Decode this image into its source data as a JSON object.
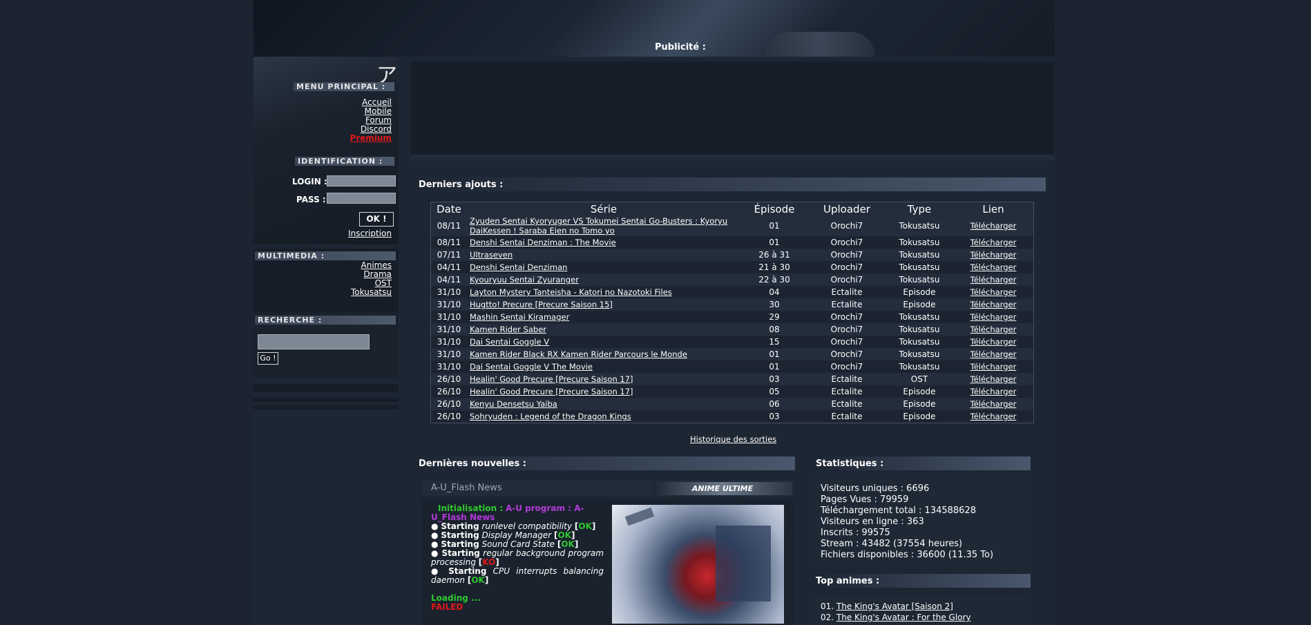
{
  "header": {
    "ad_label": "Publicité :"
  },
  "logo_glyph": "ア",
  "menu_principal": {
    "title": "Menu principal :",
    "items": [
      "Accueil",
      "Mobile",
      "Forum",
      "Discord",
      "Premium"
    ]
  },
  "identification": {
    "title": "Identification :",
    "login_label": "LOGIN :",
    "pass_label": "PASS :",
    "submit_label": "OK !",
    "register_label": "Inscription"
  },
  "multimedia": {
    "title": "Multimedia :",
    "items": [
      "Animes",
      "Drama",
      "OST",
      "Tokusatsu"
    ]
  },
  "recherche": {
    "title": "Recherche :",
    "go_label": "Go !"
  },
  "derniers_ajouts": {
    "title": "Derniers ajouts :",
    "columns": [
      "Date",
      "Série",
      "Épisode",
      "Uploader",
      "Type",
      "Lien"
    ],
    "rows": [
      {
        "date": "08/11",
        "serie": "Zyuden Sentai Kyoryuger VS Tokumei Sentai Go-Busters : Kyoryu DaiKessen ! Saraba Eien no Tomo yo",
        "episode": "01",
        "uploader": "Orochi7",
        "type": "Tokusatsu",
        "lien": "Télécharger"
      },
      {
        "date": "08/11",
        "serie": "Denshi Sentai Denziman : The Movie",
        "episode": "01",
        "uploader": "Orochi7",
        "type": "Tokusatsu",
        "lien": "Télécharger"
      },
      {
        "date": "07/11",
        "serie": "Ultraseven",
        "episode": "26 à 31",
        "uploader": "Orochi7",
        "type": "Tokusatsu",
        "lien": "Télécharger"
      },
      {
        "date": "04/11",
        "serie": "Denshi Sentai Denziman",
        "episode": "21 à 30",
        "uploader": "Orochi7",
        "type": "Tokusatsu",
        "lien": "Télécharger"
      },
      {
        "date": "04/11",
        "serie": "Kyouryuu Sentai Zyuranger",
        "episode": "22 à 30",
        "uploader": "Orochi7",
        "type": "Tokusatsu",
        "lien": "Télécharger"
      },
      {
        "date": "31/10",
        "serie": "Layton Mystery Tanteisha - Katori no Nazotoki Files",
        "episode": "04",
        "uploader": "Ectalite",
        "type": "Episode",
        "lien": "Télécharger"
      },
      {
        "date": "31/10",
        "serie": "Hugtto! Precure [Precure Saison 15]",
        "episode": "30",
        "uploader": "Ectalite",
        "type": "Episode",
        "lien": "Télécharger"
      },
      {
        "date": "31/10",
        "serie": "Mashin Sentai Kiramager",
        "episode": "29",
        "uploader": "Orochi7",
        "type": "Tokusatsu",
        "lien": "Télécharger"
      },
      {
        "date": "31/10",
        "serie": "Kamen Rider Saber",
        "episode": "08",
        "uploader": "Orochi7",
        "type": "Tokusatsu",
        "lien": "Télécharger"
      },
      {
        "date": "31/10",
        "serie": "Dai Sentai Goggle V",
        "episode": "15",
        "uploader": "Orochi7",
        "type": "Tokusatsu",
        "lien": "Télécharger"
      },
      {
        "date": "31/10",
        "serie": "Kamen Rider Black RX Kamen Rider Parcours le Monde",
        "episode": "01",
        "uploader": "Orochi7",
        "type": "Tokusatsu",
        "lien": "Télécharger"
      },
      {
        "date": "31/10",
        "serie": "Dai Sentai Goggle V The Movie",
        "episode": "01",
        "uploader": "Orochi7",
        "type": "Tokusatsu",
        "lien": "Télécharger"
      },
      {
        "date": "26/10",
        "serie": "Healin' Good Precure [Precure Saison 17]",
        "episode": "03",
        "uploader": "Ectalite",
        "type": "OST",
        "lien": "Télécharger"
      },
      {
        "date": "26/10",
        "serie": "Healin' Good Precure [Precure Saison 17]",
        "episode": "05",
        "uploader": "Ectalite",
        "type": "Episode",
        "lien": "Télécharger"
      },
      {
        "date": "26/10",
        "serie": "Kenyu Densetsu Yaiba",
        "episode": "06",
        "uploader": "Ectalite",
        "type": "Episode",
        "lien": "Télécharger"
      },
      {
        "date": "26/10",
        "serie": "Sohryuden : Legend of the Dragon Kings",
        "episode": "03",
        "uploader": "Ectalite",
        "type": "Episode",
        "lien": "Télécharger"
      }
    ],
    "history_link": "Historique des sorties"
  },
  "dernieres_nouvelles": {
    "title": "Dernières nouvelles :",
    "news_title": "A-U_Flash News",
    "news_logo": "ANIME ULTIME",
    "init_label": "Initialisation :",
    "init_value": "A-U program : A-U_Flash News",
    "lines": [
      {
        "bullet": "●",
        "starting": "Starting",
        "task": "runlevel compatibility",
        "status": "OK"
      },
      {
        "bullet": "●",
        "starting": "Starting",
        "task": "Display Manager",
        "status": "OK"
      },
      {
        "bullet": "●",
        "starting": "Starting",
        "task": "Sound Card State",
        "status": "OK"
      },
      {
        "bullet": "●",
        "starting": "Starting",
        "task": "regular background program processing",
        "status": "KO"
      },
      {
        "bullet": "●",
        "starting": "Starting",
        "task": "CPU interrupts balancing daemon",
        "status": "OK"
      }
    ],
    "loading": "Loading ...",
    "failed": "FAILED"
  },
  "statistiques": {
    "title": "Statistiques :",
    "lines": [
      "Visiteurs uniques : 6696",
      "Pages Vues : 79959",
      "Téléchargement total : 134588628",
      "Visiteurs en ligne : 363",
      "Inscrits : 99575",
      "Stream : 43482 (37554 heures)",
      "Fichiers disponibles : 36600 (11.35 To)"
    ]
  },
  "top_animes": {
    "title": "Top animes :",
    "items": [
      {
        "rank": "01.",
        "name": "The King's Avatar [Saison 2]"
      },
      {
        "rank": "02.",
        "name": "The King's Avatar : For the Glory"
      }
    ]
  }
}
